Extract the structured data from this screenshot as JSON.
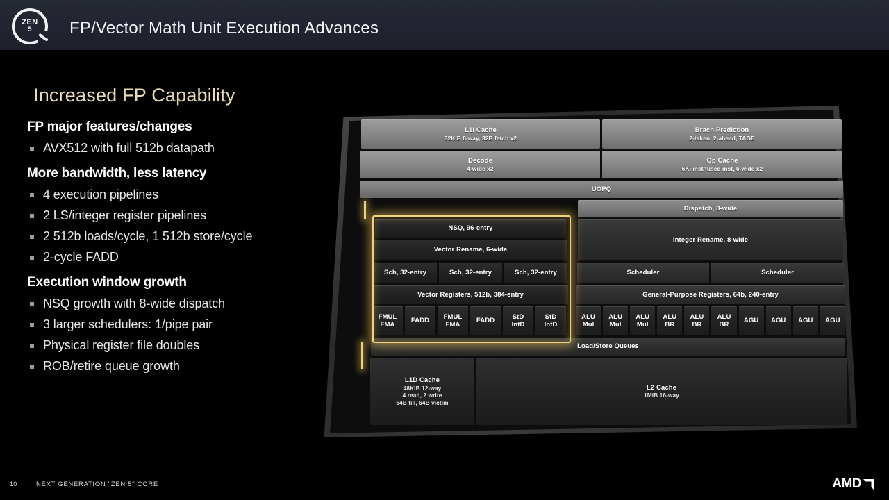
{
  "header": {
    "title": "FP/Vector Math Unit Execution Advances",
    "logo": {
      "zen": "ZEN",
      "five": "5"
    }
  },
  "section": {
    "title": "Increased FP Capability"
  },
  "content": {
    "groups": [
      {
        "heading": "FP major features/changes",
        "bullets": [
          "AVX512 with full 512b datapath"
        ]
      },
      {
        "heading": "More bandwidth, less latency",
        "bullets": [
          "4 execution pipelines",
          "2 LS/integer register pipelines",
          "2 512b loads/cycle, 1 512b store/cycle",
          "2-cycle FADD"
        ]
      },
      {
        "heading": "Execution window growth",
        "bullets": [
          "NSQ growth with 8-wide dispatch",
          "3 larger schedulers: 1/pipe pair",
          "Physical register file doubles",
          "ROB/retire queue growth"
        ]
      }
    ]
  },
  "diagram": {
    "blocks": {
      "l1i_title": "L1I Cache",
      "l1i_sub": "32KiB 8-way, 32B fetch x2",
      "bp_title": "Brach Prediction",
      "bp_sub": "2-taken, 2-ahead, TAGE",
      "decode_title": "Decode",
      "decode_sub": "4-wide x2",
      "opcache_title": "Op Cache",
      "opcache_sub": "6Ki inst/fused inst, 6-wide x2",
      "uopq": "UOPQ",
      "dispatch": "Dispatch, 8-wide",
      "nsq": "NSQ, 96-entry",
      "vector_rename": "Vector Rename, 6-wide",
      "sch": "Sch, 32-entry",
      "vector_registers": "Vector Registers, 512b, 384-entry",
      "integer_rename": "Integer Rename, 8-wide",
      "scheduler": "Scheduler",
      "gpr": "General-Purpose Registers, 64b, 240-entry",
      "lsq": "Load/Store Queues",
      "l1d_title": "L1D Cache",
      "l1d_l2": "48KiB 12-way",
      "l1d_l3": "4 read, 2 write",
      "l1d_l4": "64B fill, 64B victim",
      "l2_title": "L2 Cache",
      "l2_sub": "1MiB 16-way"
    },
    "fp_units": [
      "FMUL|FMA",
      "FADD",
      "FMUL|FMA",
      "FADD",
      "StD|IntD",
      "StD|IntD"
    ],
    "fp_units_split": [
      {
        "a": "FMUL",
        "b": "FMA"
      },
      {
        "a": "FADD",
        "b": ""
      },
      {
        "a": "FMUL",
        "b": "FMA"
      },
      {
        "a": "FADD",
        "b": ""
      },
      {
        "a": "StD",
        "b": "IntD"
      },
      {
        "a": "StD",
        "b": "IntD"
      }
    ],
    "int_units": [
      {
        "a": "ALU",
        "b": "Mul"
      },
      {
        "a": "ALU",
        "b": "Mul"
      },
      {
        "a": "ALU",
        "b": "Mul"
      },
      {
        "a": "ALU",
        "b": "BR"
      },
      {
        "a": "ALU",
        "b": "BR"
      },
      {
        "a": "ALU",
        "b": "BR"
      },
      {
        "a": "AGU",
        "b": ""
      },
      {
        "a": "AGU",
        "b": ""
      },
      {
        "a": "AGU",
        "b": ""
      },
      {
        "a": "AGU",
        "b": ""
      }
    ],
    "highlight_color": "#f0d27a"
  },
  "footer": {
    "page_number": "10",
    "text": "NEXT GENERATION \"ZEN 5\" CORE",
    "brand": "AMD"
  },
  "colors": {
    "header_bg": "#212430",
    "accent_gold": "#e9dcb2",
    "highlight": "#f0d27a",
    "background": "#000000"
  }
}
